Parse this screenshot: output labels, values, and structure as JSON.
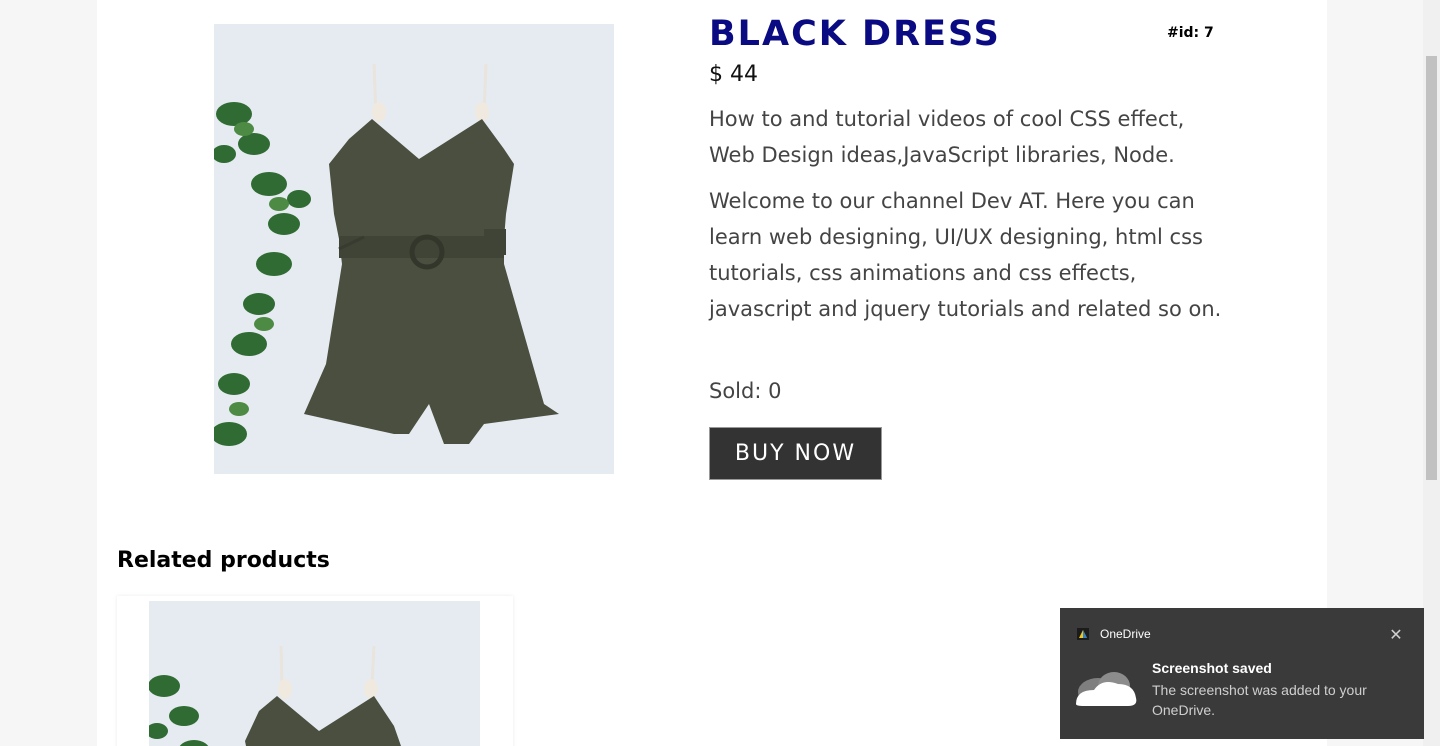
{
  "product": {
    "title": "BLACK DRESS",
    "id_label": "#id: 7",
    "price": "$ 44",
    "description_1": "How to and tutorial videos of cool CSS effect, Web Design ideas,JavaScript libraries, Node.",
    "description_2": "Welcome to our channel Dev AT. Here you can learn web designing, UI/UX designing, html css tutorials, css animations and css effects, javascript and jquery tutorials and related so on.",
    "sold": "Sold: 0",
    "buy_button": "BUY NOW",
    "image_icon": "dress-photo"
  },
  "related": {
    "heading": "Related products"
  },
  "toast": {
    "app_name": "OneDrive",
    "title": "Screenshot saved",
    "body": "The screenshot was added to your OneDrive.",
    "icon": "onedrive-cloud-icon"
  },
  "colors": {
    "title": "#0a0a82",
    "button_bg": "#333333",
    "toast_bg": "#3a3a3a"
  }
}
